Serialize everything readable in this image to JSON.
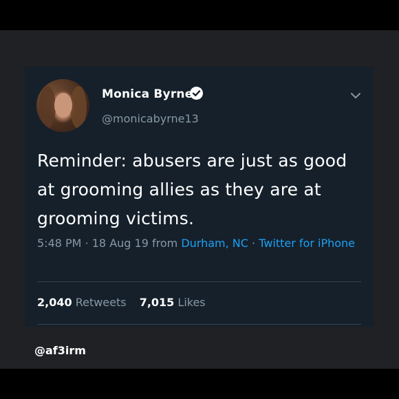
{
  "tweet": {
    "author_name": "Monica Byrne",
    "author_handle": "@monicabyrne13",
    "verified_icon": "verified-badge-icon",
    "menu_icon": "chevron-down-icon",
    "lines": [
      "Reminder: abusers are just as good",
      "at grooming allies as they are at",
      "grooming victims."
    ],
    "time": "5:48 PM",
    "separator": "·",
    "date": "18 Aug 19",
    "from_label": "from",
    "location": "Durham, NC",
    "source": "Twitter for iPhone",
    "retweets_count": "2,040",
    "retweets_label": "Retweets",
    "likes_count": "7,015",
    "likes_label": "Likes"
  },
  "watermark": "@af3irm",
  "colors": {
    "outer_bg": "#000000",
    "frame_bg": "#202124",
    "card_bg": "#15202b",
    "text": "#ffffff",
    "muted": "#8899a6",
    "link": "#1da1f2",
    "divider": "#38444d"
  }
}
